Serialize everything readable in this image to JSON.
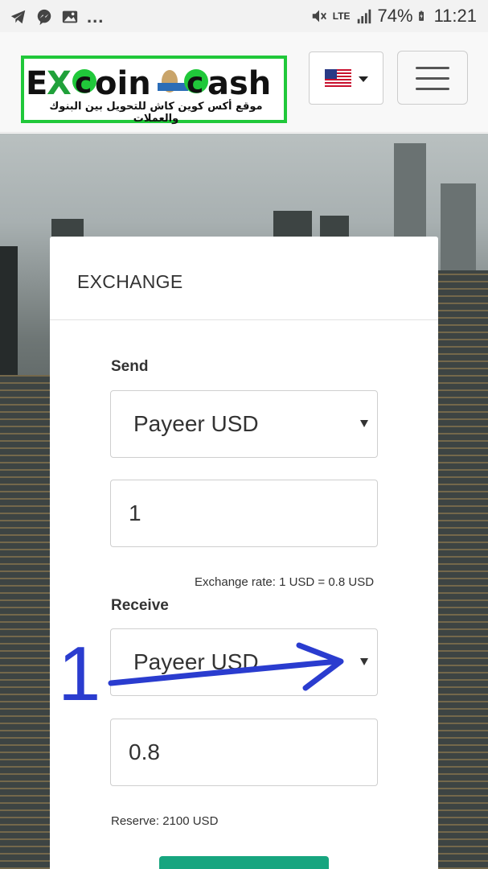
{
  "status_bar": {
    "left_overflow": "...",
    "lte": "LTE",
    "battery": "74%",
    "time": "11:21"
  },
  "header": {
    "logo_text": "EXcoinCash",
    "logo_subtitle": "موقع أكس كوين كاش للتحويل بين البنوك والعملات",
    "language": "us-flag"
  },
  "card": {
    "title": "EXCHANGE",
    "send": {
      "label": "Send",
      "currency": "Payeer USD",
      "amount": "1"
    },
    "exchange_rate": "Exchange rate: 1 USD = 0.8 USD",
    "receive": {
      "label": "Receive",
      "currency": "Payeer USD",
      "amount": "0.8"
    },
    "reserve": "Reserve: 2100 USD"
  },
  "annotation": {
    "number": "1",
    "color": "#2a3ccf"
  },
  "colors": {
    "logo_border": "#20c83a",
    "button": "#17a57f"
  }
}
